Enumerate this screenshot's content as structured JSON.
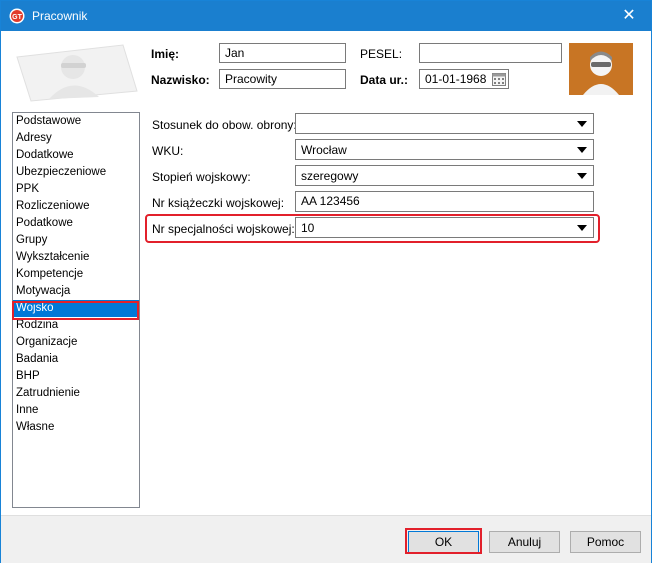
{
  "window": {
    "title": "Pracownik",
    "close_glyph": "✕"
  },
  "header": {
    "first_name_label": "Imię:",
    "first_name_value": "Jan",
    "last_name_label": "Nazwisko:",
    "last_name_value": "Pracowity",
    "pesel_label": "PESEL:",
    "pesel_value": "",
    "birth_date_label": "Data ur.:",
    "birth_date_value": "01-01-1968"
  },
  "sidebar": {
    "items": [
      {
        "label": "Podstawowe"
      },
      {
        "label": "Adresy"
      },
      {
        "label": "Dodatkowe"
      },
      {
        "label": "Ubezpieczeniowe"
      },
      {
        "label": "PPK"
      },
      {
        "label": "Rozliczeniowe"
      },
      {
        "label": "Podatkowe"
      },
      {
        "label": "Grupy"
      },
      {
        "label": "Wykształcenie"
      },
      {
        "label": "Kompetencje"
      },
      {
        "label": "Motywacja"
      },
      {
        "label": "Wojsko"
      },
      {
        "label": "Rodzina"
      },
      {
        "label": "Organizacje"
      },
      {
        "label": "Badania"
      },
      {
        "label": "BHP"
      },
      {
        "label": "Zatrudnienie"
      },
      {
        "label": "Inne"
      },
      {
        "label": "Własne"
      }
    ],
    "selected": "Wojsko"
  },
  "military": {
    "obligation_label": "Stosunek do obow. obrony:",
    "obligation_value": "",
    "wku_label": "WKU:",
    "wku_value": "Wrocław",
    "rank_label": "Stopień wojskowy:",
    "rank_value": "szeregowy",
    "booklet_label": "Nr książeczki wojskowej:",
    "booklet_value": "AA 123456",
    "specialty_label": "Nr specjalności wojskowej:",
    "specialty_value": "10"
  },
  "footer": {
    "ok_label": "OK",
    "cancel_label": "Anuluj",
    "help_label": "Pomoc"
  },
  "colors": {
    "titlebar": "#1a7fcf",
    "selection": "#0078d7",
    "highlight": "#e2202b",
    "avatar_bg": "#c87524"
  }
}
